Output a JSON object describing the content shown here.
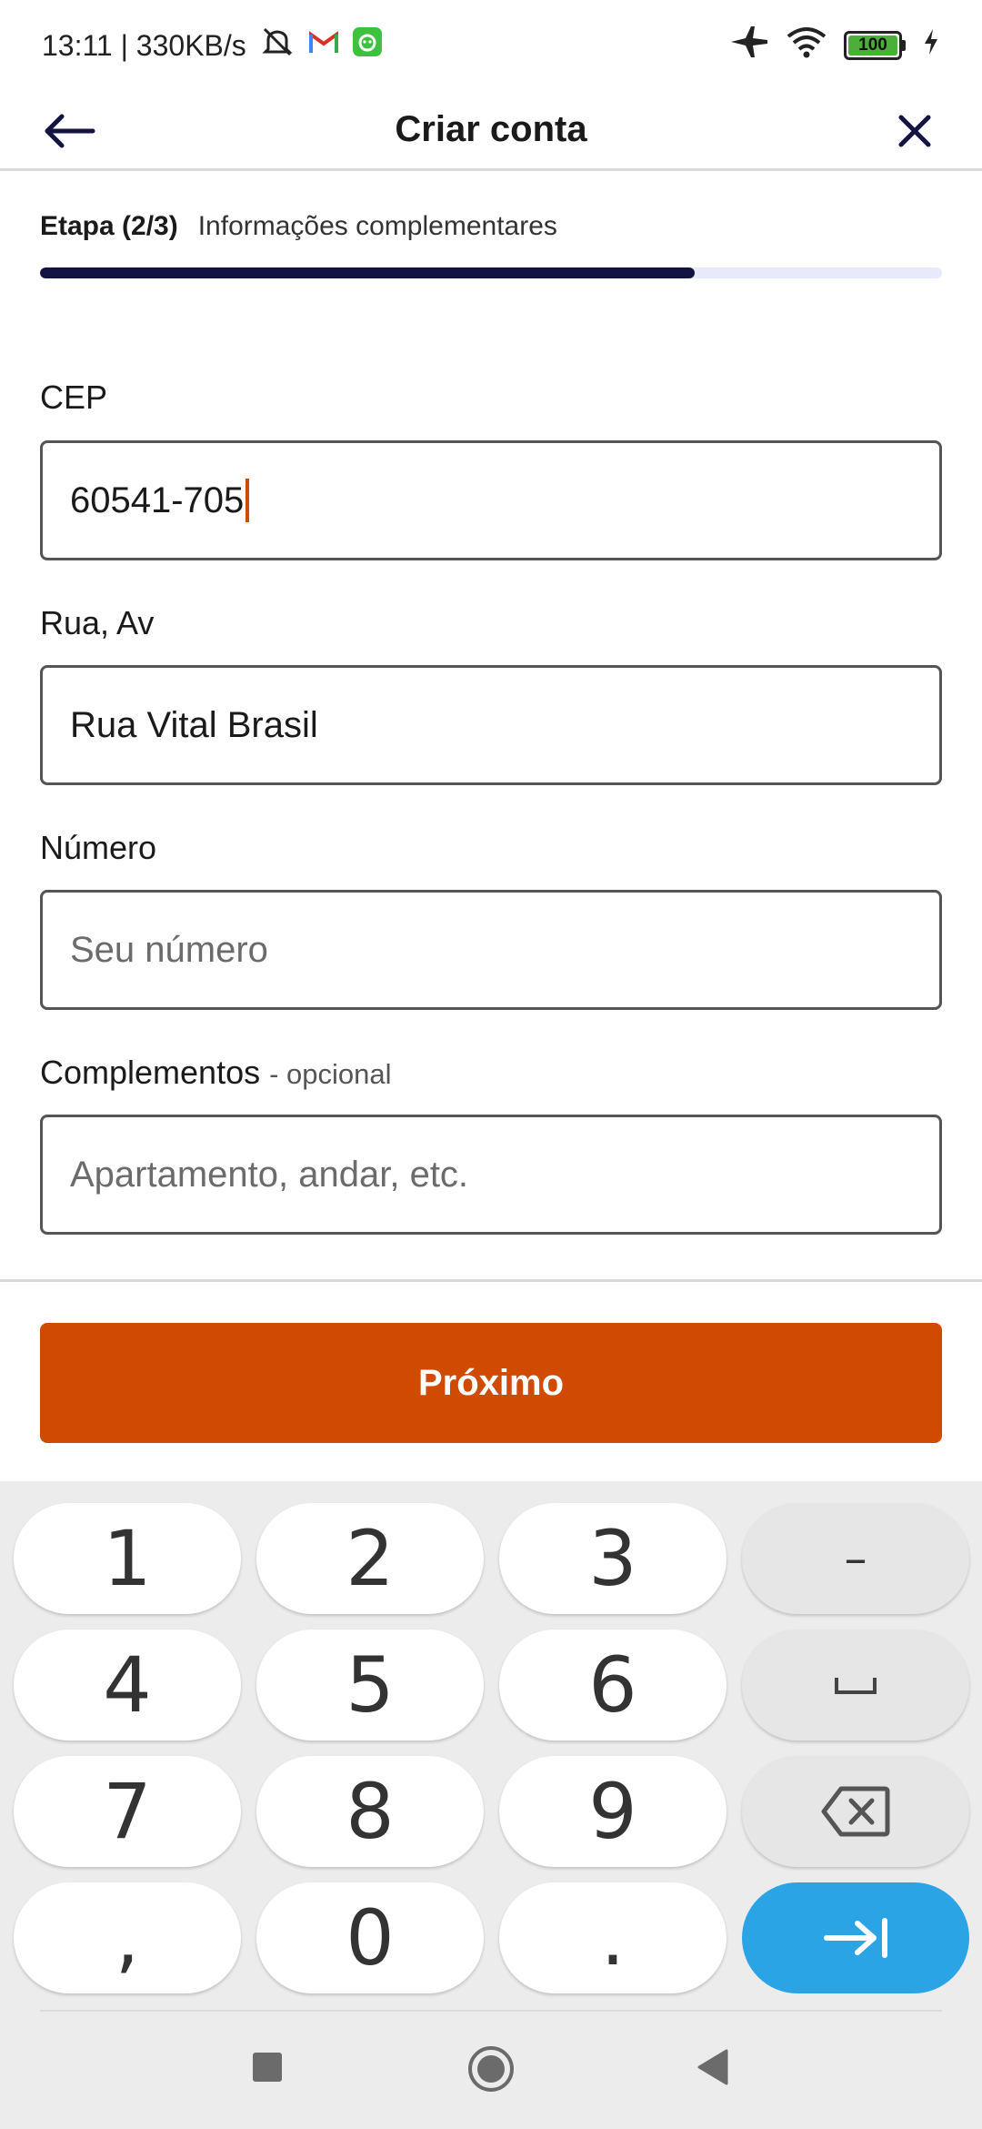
{
  "status_bar": {
    "time_speed": "13:11 | 330KB/s",
    "battery_level": "100"
  },
  "header": {
    "title": "Criar conta",
    "back_icon": "arrow-left-icon",
    "close_icon": "close-icon"
  },
  "step": {
    "label": "Etapa (2/3)",
    "description": "Informações complementares",
    "progress_fraction": 0.7262
  },
  "form": {
    "cep": {
      "label": "CEP",
      "value": "60541-705"
    },
    "street": {
      "label": "Rua, Av",
      "value": "Rua Vital Brasil"
    },
    "number": {
      "label": "Número",
      "placeholder": "Seu número"
    },
    "complement": {
      "label": "Complementos",
      "optional_note": "- opcional",
      "placeholder": "Apartamento, andar, etc."
    }
  },
  "next_button": {
    "label": "Próximo"
  },
  "keyboard": {
    "keys": [
      "1",
      "2",
      "3",
      "4",
      "5",
      "6",
      "7",
      "8",
      "9",
      ",",
      "0",
      "."
    ],
    "function_keys": [
      "minus-key",
      "space-key",
      "backspace-icon",
      "enter-tab-icon"
    ],
    "minus_label": "–"
  },
  "colors": {
    "accent_orange": "#d04a02",
    "progress_dark": "#141443",
    "progress_track": "#e8e9fb",
    "enter_key_blue": "#2ba4e6"
  }
}
